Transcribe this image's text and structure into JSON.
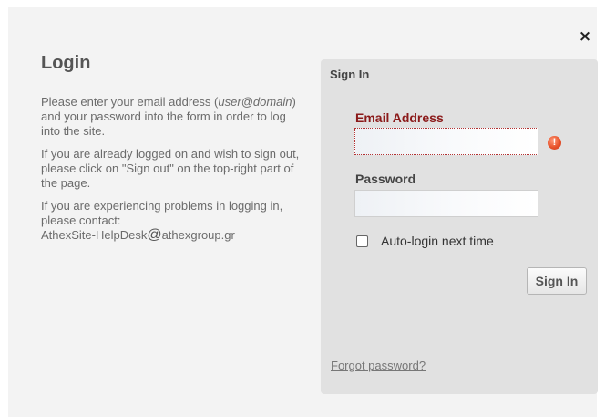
{
  "dialog": {
    "close_symbol": "×",
    "title": "Login",
    "help": {
      "p1_a": "Please enter your email address (",
      "p1_em": "user@domain",
      "p1_b": ") and your password into the form in order to log into the site.",
      "p2": "If you are already logged on and wish to sign out, please click on \"Sign out\" on the top-right part of the page.",
      "p3_a": "If you are experiencing problems in logging in, please contact:",
      "p3_email_user": "AthexSite-HelpDesk",
      "p3_at": "@",
      "p3_email_domain": "athexgroup.gr"
    }
  },
  "signin": {
    "panel_title": "Sign In",
    "email_label": "Email Address",
    "email_value": "",
    "error_icon": "!",
    "password_label": "Password",
    "password_value": "",
    "autologin_label": "Auto-login next time",
    "button_label": "Sign In",
    "forgot_label": "Forgot password?"
  },
  "colors": {
    "error": "#8b1a1a",
    "panel": "#e1e1e1",
    "background": "#f3f3f3"
  }
}
